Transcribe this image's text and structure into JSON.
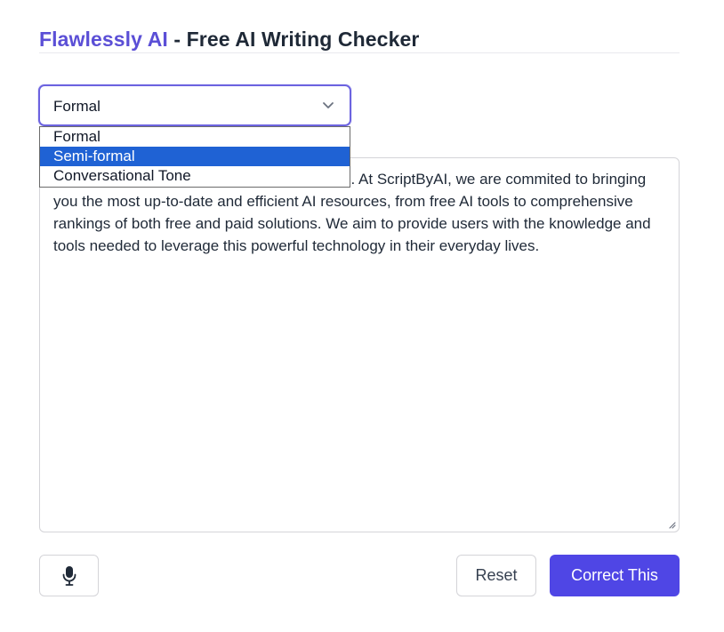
{
  "header": {
    "brand": "Flawlessly AI",
    "rest": " - Free AI Writing Checker"
  },
  "tone_select": {
    "value": "Formal",
    "options": [
      "Formal",
      "Semi-formal",
      "Conversational Tone"
    ],
    "highlighted": "Semi-formal"
  },
  "editor": {
    "text_visible": "r destination for exploring the latet in AI tools. At ScriptByAI, we are commited to bringing you the most up-to-date and efficient AI resources, from free AI tools to comprehensive rankings of both free and paid solutions. We aim to provide users with the knowledge and tools needed to leverage this powerful technology in their everyday lives."
  },
  "actions": {
    "mic_icon": "microphone-icon",
    "reset_label": "Reset",
    "correct_label": "Correct This"
  },
  "colors": {
    "brand": "#5b4fd6",
    "primary": "#4f46e5",
    "highlight": "#1f62d4"
  }
}
